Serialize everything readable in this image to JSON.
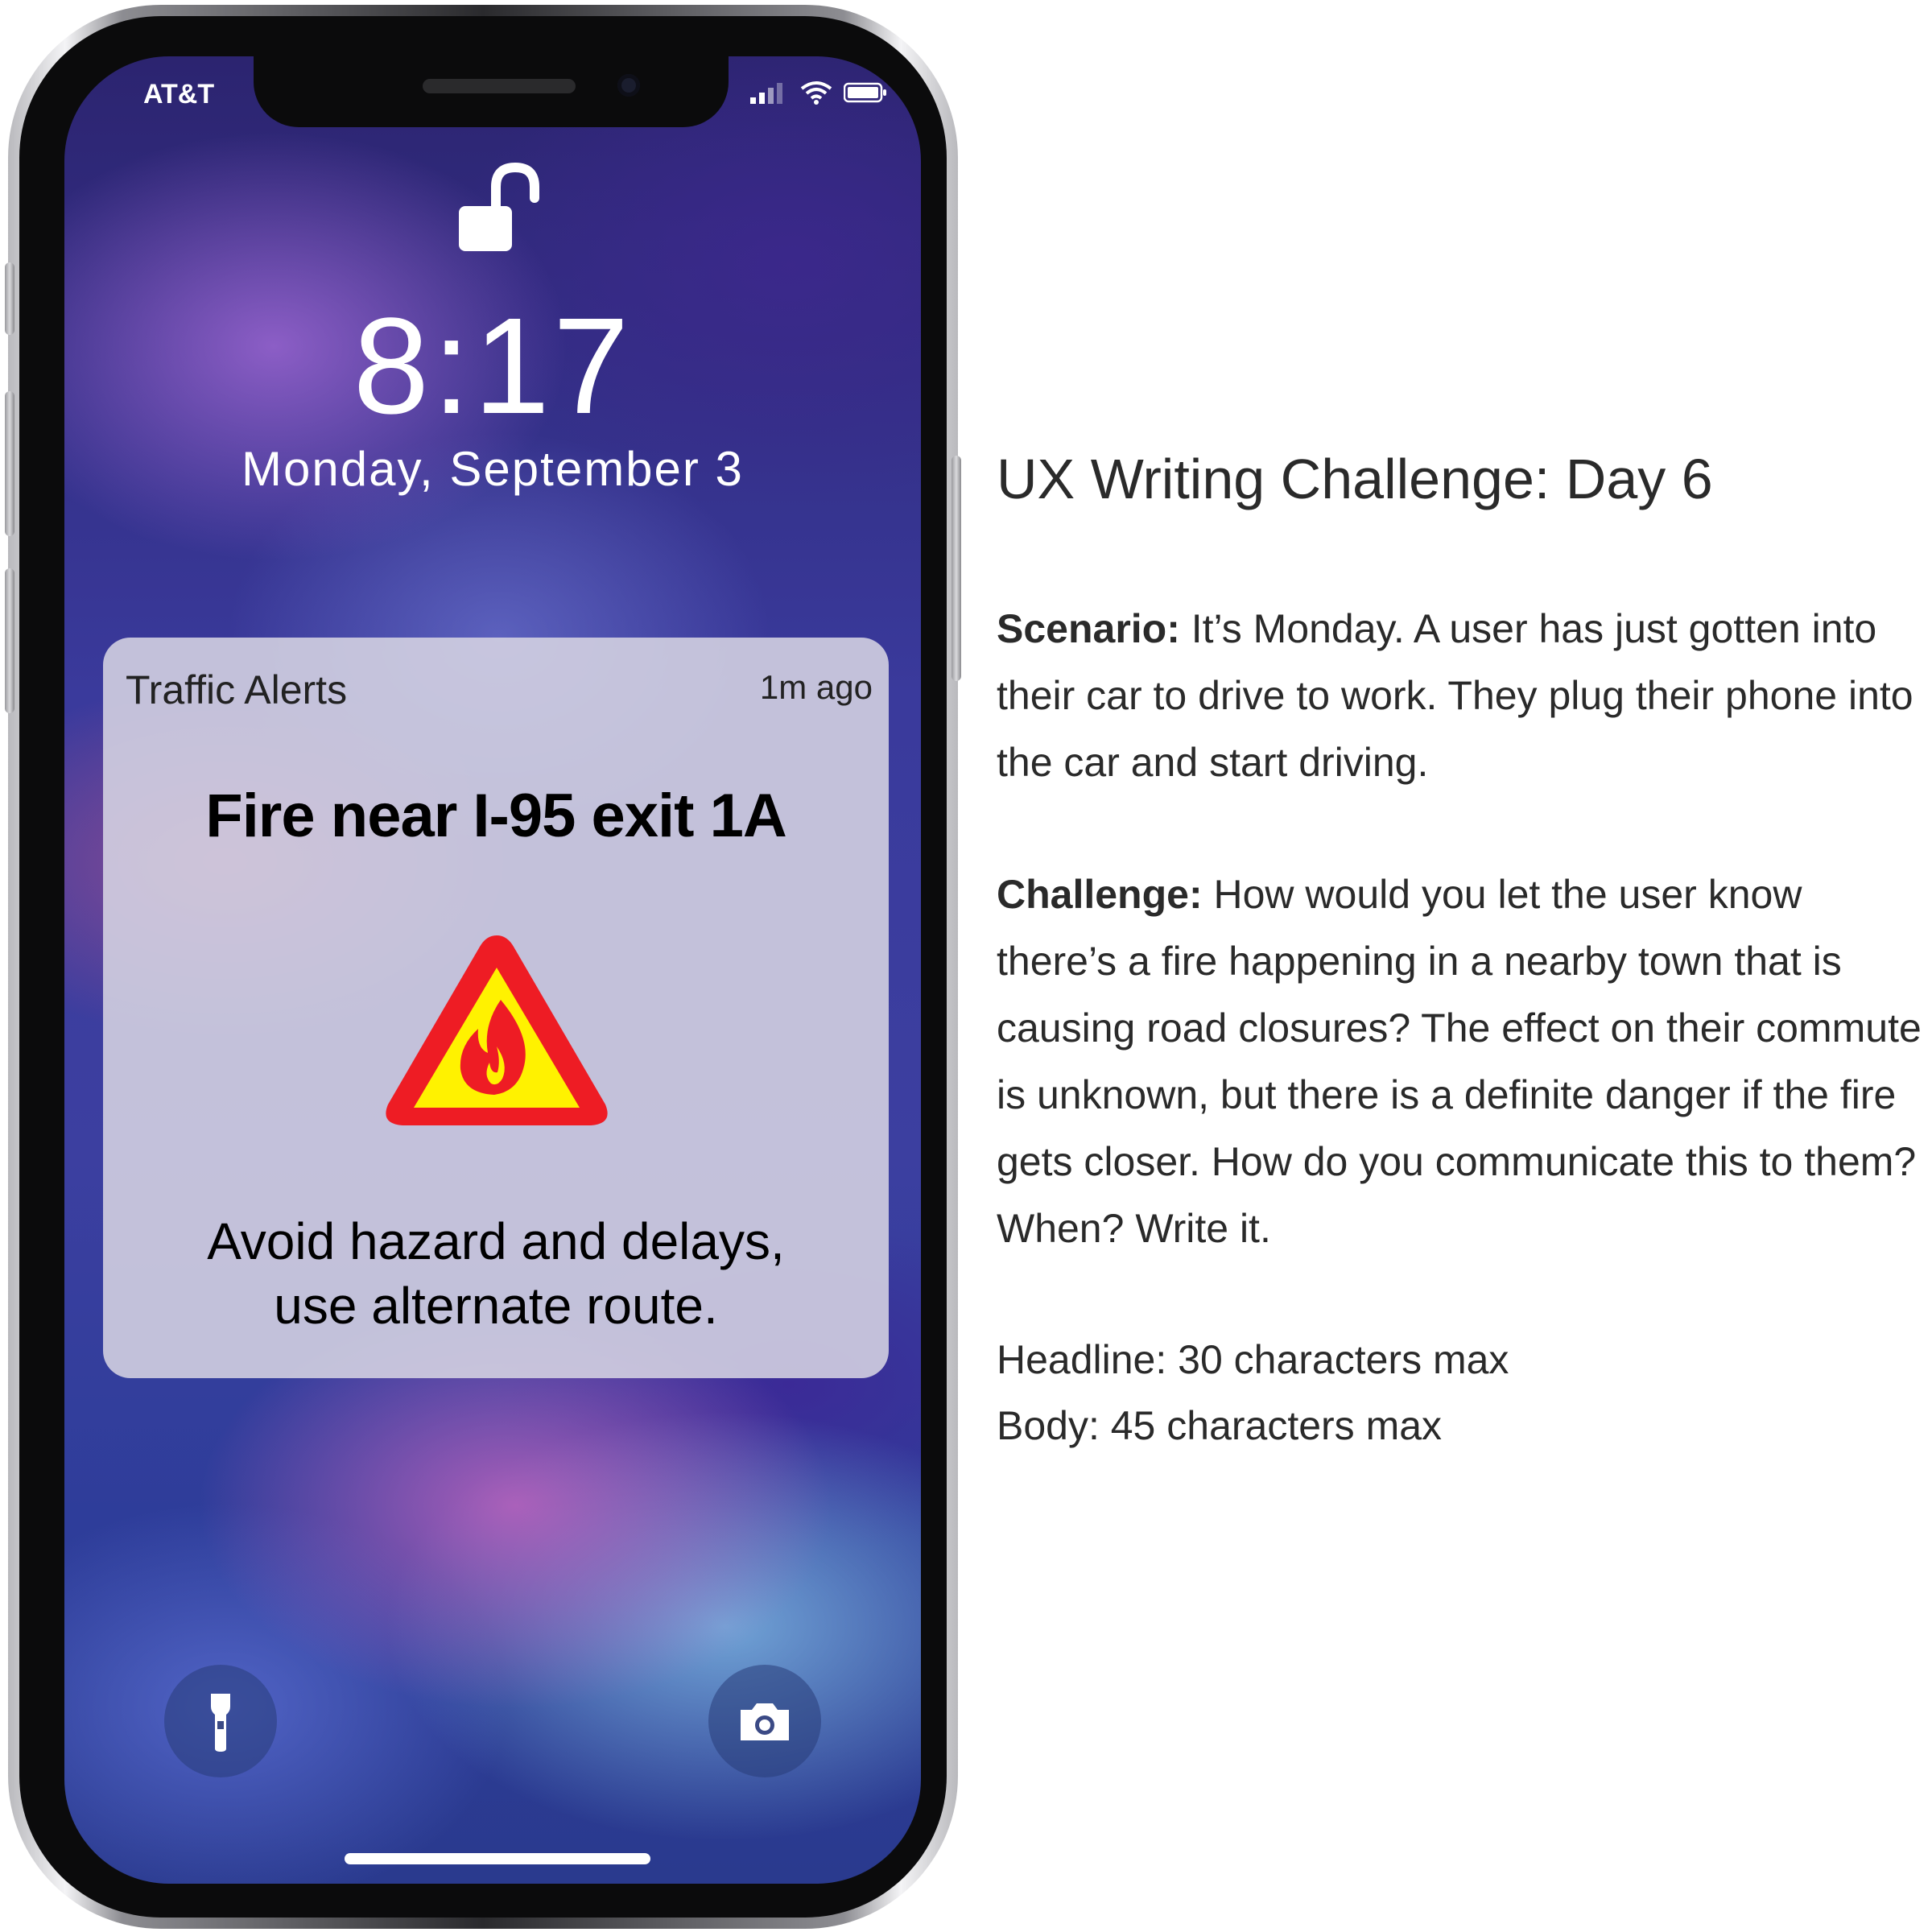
{
  "phone": {
    "carrier": "AT&T",
    "time": "8:17",
    "date": "Monday, September 3"
  },
  "notification": {
    "app_name": "Traffic Alerts",
    "timestamp": "1m ago",
    "title": "Fire near I-95 exit 1A",
    "body_line1": "Avoid hazard and delays,",
    "body_line2": "use alternate route.",
    "icon": "fire-hazard-icon"
  },
  "lockscreen_buttons": {
    "left": "flashlight-icon",
    "right": "camera-icon"
  },
  "challenge": {
    "title": "UX Writing Challenge: Day 6",
    "scenario_label": "Scenario:",
    "scenario_text": "It’s Monday. A user has just gotten into their car to drive to work. They plug their phone into the car and start driving.",
    "challenge_label": "Challenge:",
    "challenge_text": "How would you let the user know there’s a fire happening in a nearby town that is causing road closures? The effect on their commute is unknown, but there is a definite danger if the fire gets closer. How do you communicate this to them? When? Write it.",
    "headline_limit": "Headline: 30 characters max",
    "body_limit": "Body: 45 characters max"
  },
  "colors": {
    "hazard_red": "#ee1c24",
    "hazard_yellow": "#fff200"
  }
}
